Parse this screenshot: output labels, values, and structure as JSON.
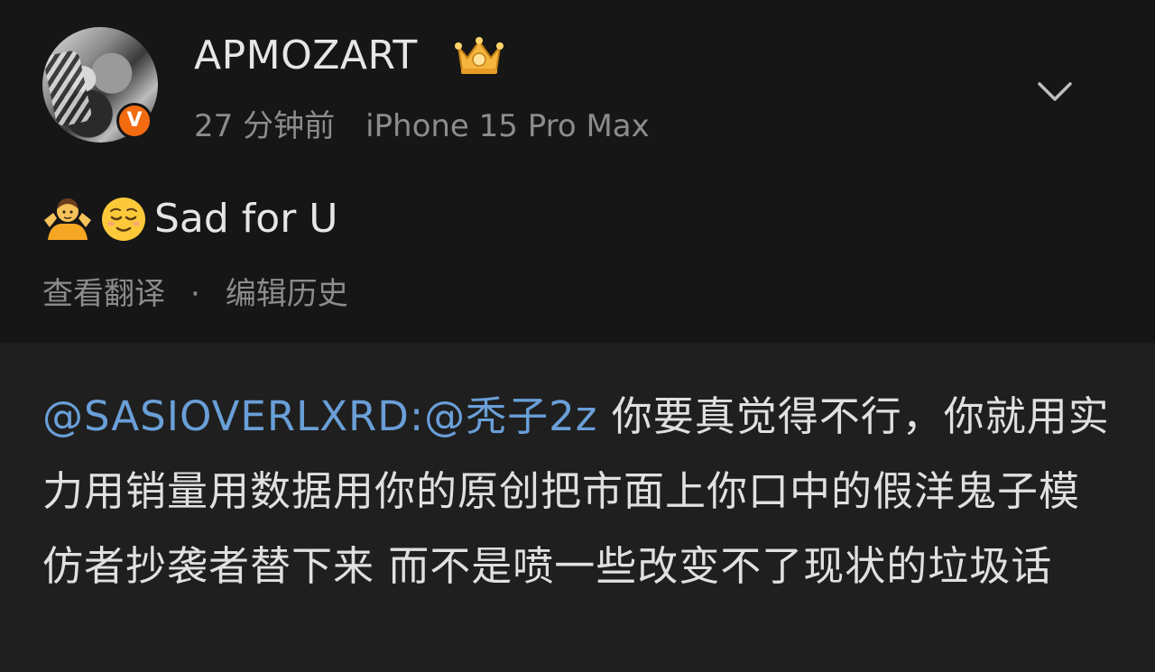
{
  "post": {
    "username": "APMOZART",
    "verified_badge": "V",
    "time": "27 分钟前",
    "device": "iPhone 15 Pro Max",
    "text": "Sad for U",
    "emojis": [
      "person-shrugging",
      "relieved-face"
    ],
    "actions": {
      "translate": "查看翻译",
      "separator": "·",
      "edit_history": "编辑历史"
    },
    "icons": {
      "avatar": "avatar-image",
      "crown": "crown-icon",
      "menu": "chevron-down-icon"
    }
  },
  "reply": {
    "mention1": "@SASIOVERLXRD",
    "colon": ":",
    "mention2": "@秃子2z",
    "body": " 你要真觉得不行，你就用实力用销量用数据用你的原创把市面上你口中的假洋鬼子模仿者抄袭者替下来 而不是喷一些改变不了现状的垃圾话"
  },
  "colors": {
    "background": "#161616",
    "reply_background": "#1f1f1f",
    "mention": "#6a9fd8",
    "badge": "#f26b11",
    "secondary_text": "#8c8c8c"
  }
}
